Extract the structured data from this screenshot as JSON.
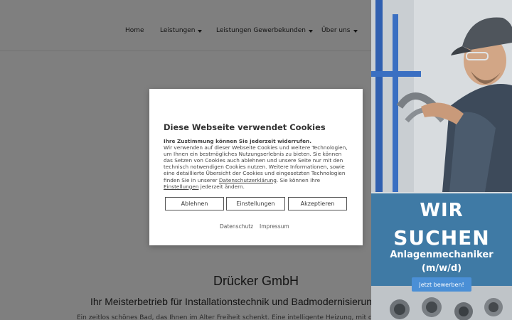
{
  "nav": {
    "items": [
      {
        "label": "Home",
        "dropdown": false
      },
      {
        "label": "Leistungen",
        "dropdown": true
      },
      {
        "label": "Leistungen Gewerbekunden",
        "dropdown": true
      },
      {
        "label": "Über uns",
        "dropdown": true
      }
    ]
  },
  "main": {
    "company": "Drücker GmbH",
    "tagline": "Ihr Meisterbetrieb für Installationstechnik und Badmodernisierung",
    "body": "Ein zeitlos schönes Bad, das Ihnen im Alter Freiheit schenkt. Eine intelligente Heizung, mit der Sie nach..."
  },
  "ad": {
    "line1": "WIR",
    "line2": "SUCHEN",
    "job": "Anlagenmechaniker",
    "gender": "(m/w/d)",
    "button": "Jetzt bewerben!"
  },
  "cookie": {
    "title": "Diese Webseite verwendet Cookies",
    "lead": "Ihre Zustimmung können Sie jederzeit widerrufen.",
    "text_before_link1": "Wir verwenden auf dieser Webseite Cookies und weitere Technologien, um Ihnen ein bestmögliches Nutzungserlebnis zu bieten. Sie können das Setzen von Cookies auch ablehnen und unsere Seite nur mit den technisch notwendigen Cookies nutzen. Weitere Informationen, sowie eine detaillierte Übersicht der Cookies und eingesetzten Technologien finden Sie in unserer ",
    "link1": "Datenschutzerklärung",
    "text_between": ". Sie können Ihre ",
    "link2": "Einstellungen",
    "text_after": " jederzeit ändern.",
    "buttons": {
      "decline": "Ablehnen",
      "settings": "Einstellungen",
      "accept": "Akzeptieren"
    },
    "footer": {
      "privacy": "Datenschutz",
      "imprint": "Impressum"
    }
  },
  "colors": {
    "overlay": "rgba(0,0,0,0.5)",
    "ad_band": "#2f6f9f",
    "ad_button": "#4a8fd6"
  }
}
